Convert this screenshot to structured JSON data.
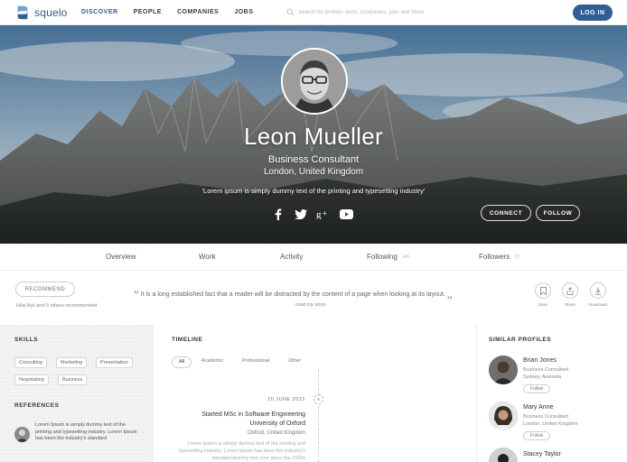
{
  "brand": {
    "name": "squelo",
    "accent": "#2f5f93"
  },
  "nav": {
    "links": [
      "DISCOVER",
      "PEOPLE",
      "COMPANIES",
      "JOBS"
    ],
    "search_placeholder": "Search for profiles, work, companies, jobs and more",
    "login": "LOG IN"
  },
  "profile": {
    "name": "Leon Mueller",
    "title": "Business Consultant",
    "location": "London, United Kingdom",
    "quote": "'Lorem ipsum is simply dummy text of the printing and typesetting industry'",
    "socials": [
      "facebook-icon",
      "twitter-icon",
      "google-plus-icon",
      "youtube-icon"
    ],
    "connect": "CONNECT",
    "follow": "FOLLOW"
  },
  "tabs": [
    {
      "label": "Overview"
    },
    {
      "label": "Work"
    },
    {
      "label": "Activity"
    },
    {
      "label": "Following",
      "count": "145"
    },
    {
      "label": "Followers",
      "count": "23"
    }
  ],
  "actions": {
    "recommend": "RECOMMEND",
    "recommend_note": "Hilal Ayil and 9 others recommended",
    "quote": "It is a long established fact that a reader will be distracted by the content of a page when looking at its layout.",
    "read_story": "read my story",
    "save": "Save",
    "share": "Share",
    "download": "Download"
  },
  "skills": {
    "heading": "SKILLS",
    "items": [
      "Consulting",
      "Marketing",
      "Presentation",
      "Negotiating",
      "Business"
    ]
  },
  "references": {
    "heading": "REFERENCES",
    "text": "Lorem Ipsum is simply dummy text of the printing and typesetting industry. Lorem Ipsum has been the industry's standard"
  },
  "timeline": {
    "heading": "TIMELINE",
    "filters": [
      "All",
      "Academic",
      "Professional",
      "Other"
    ],
    "entry": {
      "date": "20 JUNE 2015",
      "title": "Started MSc in Software Engineering",
      "org": "University of Oxford",
      "location": "Oxford, United Kingdom",
      "desc": "Lorem Ipsum is simply dummy text of the printing and typesetting industry. Lorem Ipsum has been the industry's standard dummy text ever since the 1500s"
    }
  },
  "similar": {
    "heading": "SIMILAR PROFILES",
    "people": [
      {
        "name": "Brian Jones",
        "role": "Business Consultant",
        "location": "Sydney, Australia",
        "follow": "Follow"
      },
      {
        "name": "Mary Anne",
        "role": "Business Consultant",
        "location": "London, United Kingdom",
        "follow": "Follow"
      },
      {
        "name": "Stacey Taylor"
      }
    ]
  }
}
